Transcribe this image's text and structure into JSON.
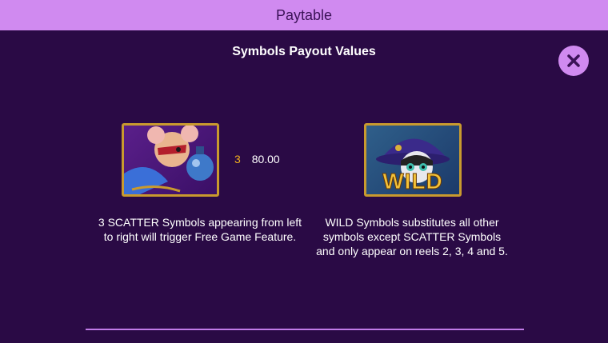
{
  "header": {
    "title": "Paytable"
  },
  "section": {
    "title": "Symbols Payout Values"
  },
  "close": {
    "icon": "close-icon"
  },
  "symbols": [
    {
      "icon": "scatter-mouse-wizard-icon",
      "payout": {
        "count": "3",
        "value": "80.00"
      },
      "description": "3 SCATTER Symbols appearing from left to right will trigger Free Game Feature."
    },
    {
      "icon": "wild-cat-wizard-icon",
      "badge": "WILD",
      "description": "WILD Symbols substitutes all other symbols except SCATTER Symbols and only appear on reels 2, 3, 4 and 5."
    }
  ],
  "colors": {
    "background": "#2a0a45",
    "header": "#d08af0",
    "accent": "#f2b01e",
    "frame": "#c99a2e"
  }
}
